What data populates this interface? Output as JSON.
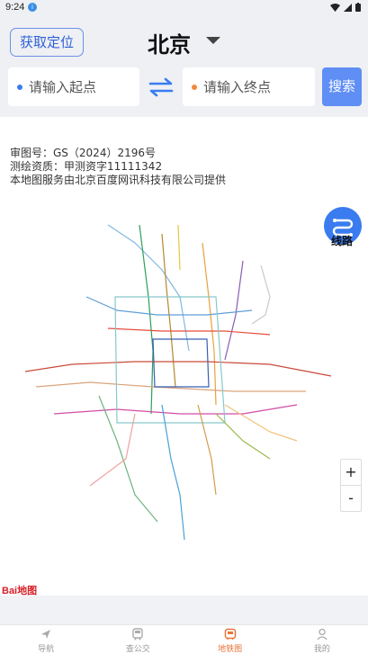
{
  "status_bar": {
    "time": "9:24",
    "notification_badge": "i"
  },
  "header": {
    "locate_button": "获取定位",
    "city": "北京"
  },
  "route_form": {
    "start_placeholder": "请输入起点",
    "end_placeholder": "请输入终点",
    "search_button": "搜索",
    "start_dot_color": "#3a7cf0",
    "end_dot_color": "#f08a3c"
  },
  "map": {
    "notes": [
      "审图号：GS（2024）2196号",
      "测绘资质：甲测资字11111342",
      "本地图服务由北京百度网讯科技有限公司提供"
    ],
    "route_button_label": "线路",
    "zoom_in": "+",
    "zoom_out": "-",
    "logo": "Bai地图"
  },
  "tabs": [
    {
      "label": "导航",
      "icon": "navigation-icon"
    },
    {
      "label": "查公交",
      "icon": "bus-icon"
    },
    {
      "label": "地铁图",
      "icon": "subway-icon",
      "active": true
    },
    {
      "label": "我的",
      "icon": "user-icon"
    }
  ],
  "colors": {
    "accent": "#5f8ef5",
    "active_tab": "#e8733a"
  }
}
